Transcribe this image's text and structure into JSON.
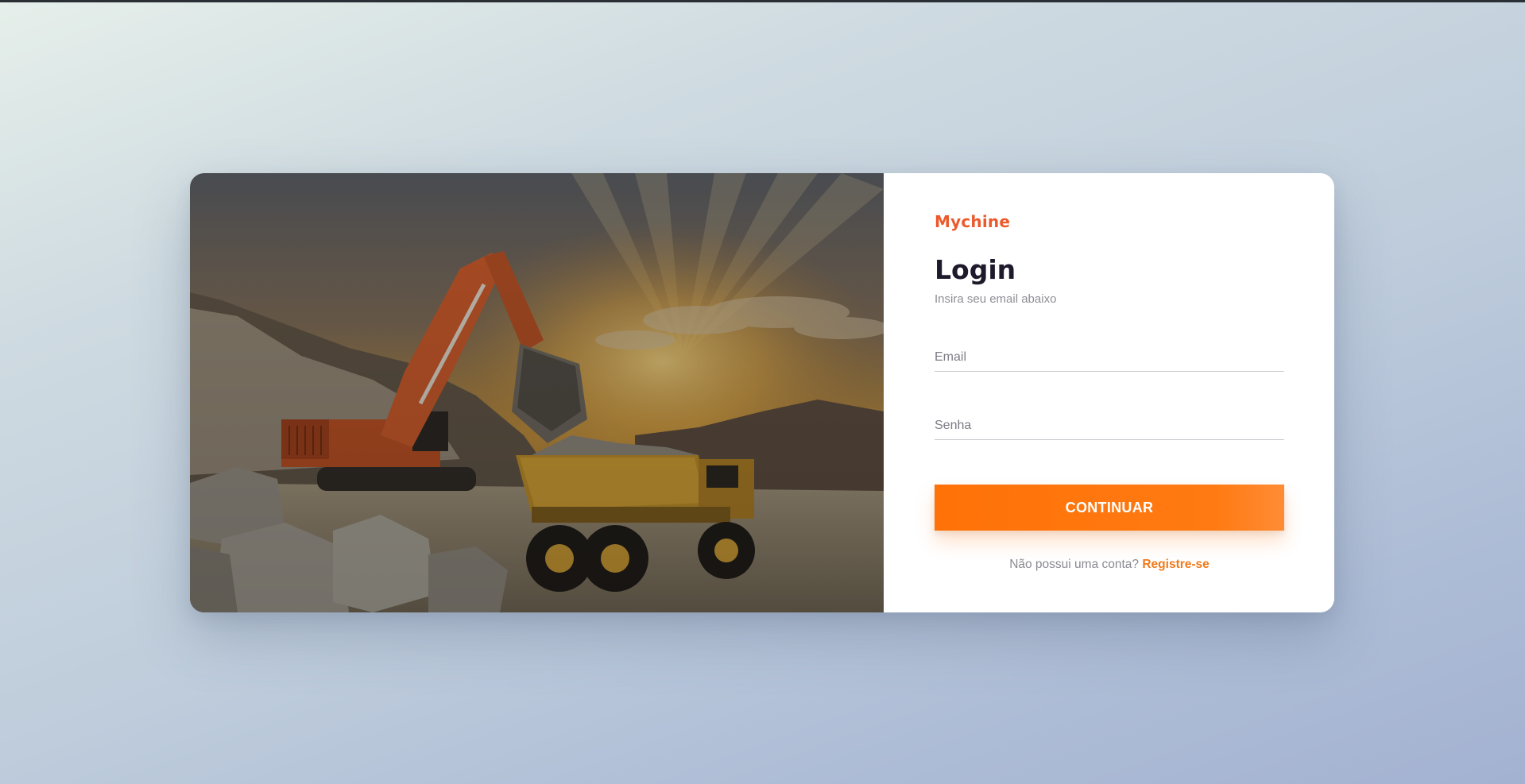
{
  "brand": {
    "name": "Mychine",
    "color": "#ec5a2c"
  },
  "login": {
    "title": "Login",
    "subtitle": "Insira seu email abaixo",
    "email_placeholder": "Email",
    "password_placeholder": "Senha",
    "submit_label": "CONTINUAR",
    "register_prompt": "Não possui uma conta?",
    "register_link": "Registre-se"
  },
  "hero": {
    "icon": "construction-scene-image"
  },
  "colors": {
    "accent": "#ff7208",
    "title": "#1f1a2b"
  }
}
